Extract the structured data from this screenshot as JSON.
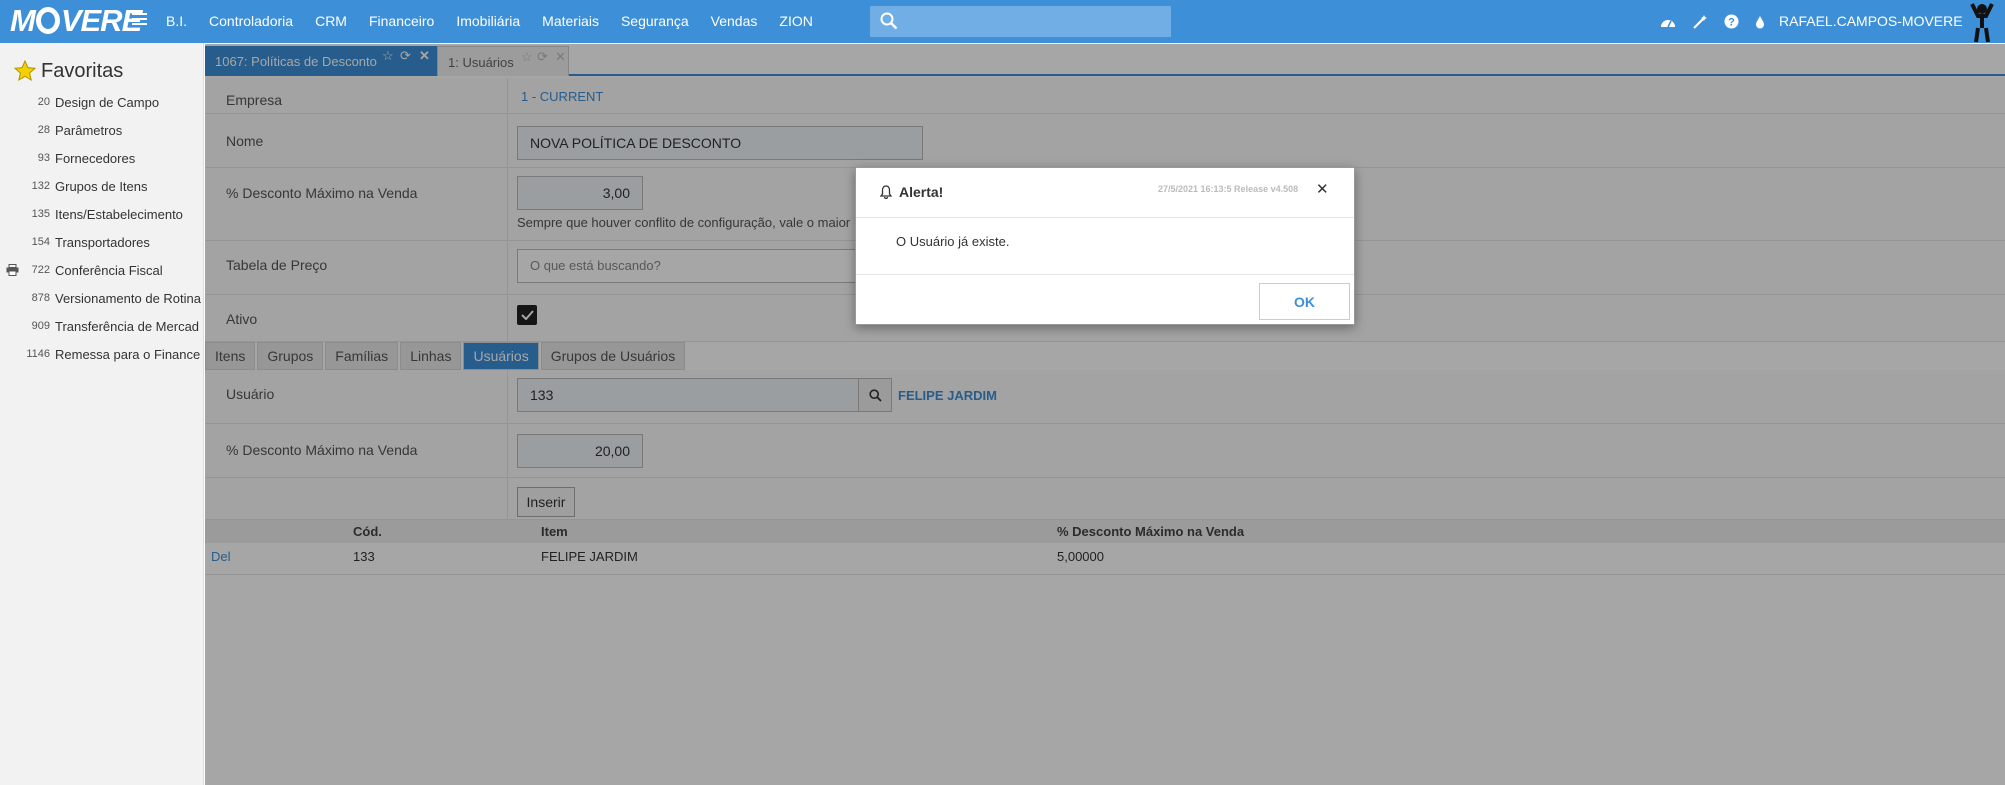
{
  "app": {
    "logo": "MOVERE"
  },
  "nav": {
    "items": [
      "B.I.",
      "Controladoria",
      "CRM",
      "Financeiro",
      "Imobiliária",
      "Materiais",
      "Segurança",
      "Vendas",
      "ZION"
    ]
  },
  "search": {
    "placeholder": ""
  },
  "user": {
    "name": "RAFAEL.CAMPOS-MOVERE"
  },
  "sidebar": {
    "title": "Favoritas",
    "items": [
      {
        "num": "20",
        "label": "Design de Campo"
      },
      {
        "num": "28",
        "label": "Parâmetros"
      },
      {
        "num": "93",
        "label": "Fornecedores"
      },
      {
        "num": "132",
        "label": "Grupos de Itens"
      },
      {
        "num": "135",
        "label": "Itens/Estabelecimento"
      },
      {
        "num": "154",
        "label": "Transportadores"
      },
      {
        "num": "722",
        "label": "Conferência Fiscal"
      },
      {
        "num": "878",
        "label": "Versionamento de Rotina"
      },
      {
        "num": "909",
        "label": "Transferência de Mercad"
      },
      {
        "num": "1146",
        "label": "Remessa para o Finance"
      }
    ]
  },
  "tabs": [
    {
      "label": "1067: Políticas de Desconto"
    },
    {
      "label": "1: Usuários"
    }
  ],
  "form": {
    "empresa_label": "Empresa",
    "empresa_value": "1 - CURRENT",
    "nome_label": "Nome",
    "nome_value": "NOVA POLÍTICA DE DESCONTO",
    "desconto_label": "% Desconto Máximo na Venda",
    "desconto_value": "3,00",
    "desconto_hint": "Sempre que houver conflito de configuração, vale o maior",
    "tabela_label": "Tabela de Preço",
    "tabela_placeholder": "O que está buscando?",
    "ativo_label": "Ativo",
    "ativo_checked": true
  },
  "subtabs": [
    "Itens",
    "Grupos",
    "Famílias",
    "Linhas",
    "Usuários",
    "Grupos de Usuários"
  ],
  "subtab_active": "Usuários",
  "subform": {
    "usuario_label": "Usuário",
    "usuario_value": "133",
    "usuario_name": "FELIPE JARDIM",
    "desconto_label": "% Desconto Máximo na Venda",
    "desconto_value": "20,00",
    "inserir_label": "Inserir"
  },
  "grid": {
    "headers": [
      "Cód.",
      "Item",
      "% Desconto Máximo na Venda"
    ],
    "rows": [
      {
        "action": "Del",
        "cod": "133",
        "item": "FELIPE JARDIM",
        "desconto": "5,00000"
      }
    ]
  },
  "modal": {
    "title": "Alerta!",
    "meta": "27/5/2021 16:13:5 Release v4.508",
    "message": "O Usuário já existe.",
    "ok_label": "OK"
  },
  "colors": {
    "accent": "#3d8fd8",
    "topbar": "#3d8fd8",
    "link": "#3d8fd8"
  }
}
